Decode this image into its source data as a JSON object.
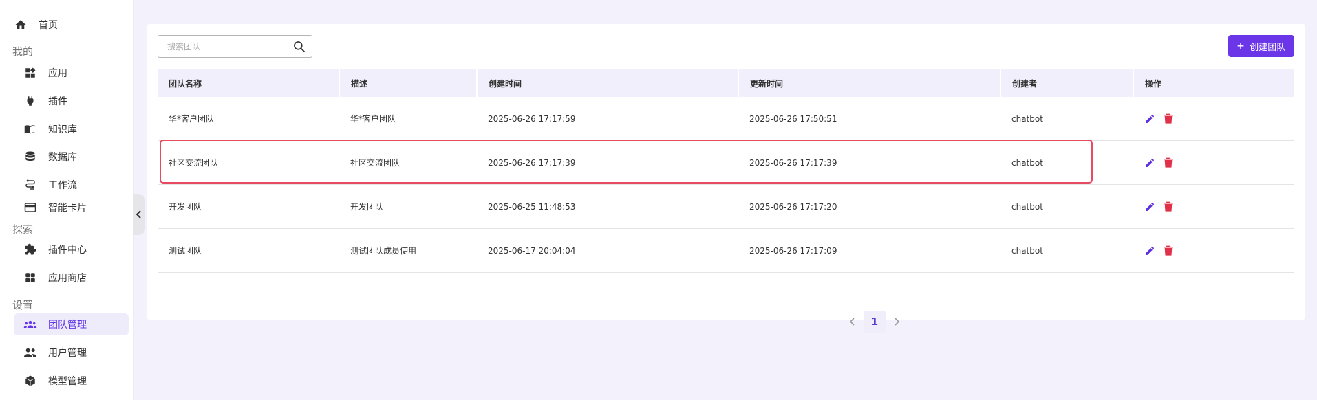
{
  "sidebar": {
    "home": {
      "label": "首页",
      "icon": "home-icon"
    },
    "sections": [
      {
        "title": "我的",
        "items": [
          {
            "label": "应用",
            "icon": "apps-icon"
          },
          {
            "label": "插件",
            "icon": "plug-icon"
          },
          {
            "label": "知识库",
            "icon": "book-icon"
          },
          {
            "label": "数据库",
            "icon": "database-icon"
          },
          {
            "label": "工作流",
            "icon": "workflow-icon"
          },
          {
            "label": "智能卡片",
            "icon": "card-icon"
          }
        ]
      },
      {
        "title": "探索",
        "items": [
          {
            "label": "插件中心",
            "icon": "puzzle-icon"
          },
          {
            "label": "应用商店",
            "icon": "grid-icon"
          }
        ]
      },
      {
        "title": "设置",
        "items": [
          {
            "label": "团队管理",
            "icon": "team-icon",
            "active": true
          },
          {
            "label": "用户管理",
            "icon": "users-icon"
          },
          {
            "label": "模型管理",
            "icon": "cube-icon"
          }
        ]
      }
    ]
  },
  "toolbar": {
    "search_placeholder": "搜索团队",
    "create_label": "创建团队"
  },
  "table": {
    "columns": [
      "团队名称",
      "描述",
      "创建时间",
      "更新时间",
      "创建者",
      "操作"
    ],
    "rows": [
      {
        "name": "华*客户团队",
        "desc": "华*客户团队",
        "created": "2025-06-26 17:17:59",
        "updated": "2025-06-26 17:50:51",
        "creator": "chatbot"
      },
      {
        "name": "社区交流团队",
        "desc": "社区交流团队",
        "created": "2025-06-26 17:17:39",
        "updated": "2025-06-26 17:17:39",
        "creator": "chatbot"
      },
      {
        "name": "开发团队",
        "desc": "开发团队",
        "created": "2025-06-25 11:48:53",
        "updated": "2025-06-26 17:17:20",
        "creator": "chatbot"
      },
      {
        "name": "测试团队",
        "desc": "测试团队成员使用",
        "created": "2025-06-17 20:04:04",
        "updated": "2025-06-26 17:17:09",
        "creator": "chatbot"
      }
    ]
  },
  "pagination": {
    "current": "1"
  },
  "colors": {
    "accent": "#6b35e8",
    "delete": "#e0304a",
    "highlight": "#e84a62"
  }
}
